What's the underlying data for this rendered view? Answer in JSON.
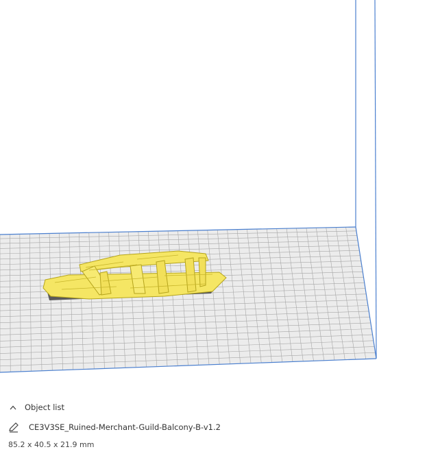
{
  "viewport": {
    "colors": {
      "background": "#ffffff",
      "plate": "#ececec",
      "grid": "#a6a6a6",
      "volume_edge": "#4a7fcf",
      "model": "#f5e664",
      "model_outline": "#b5a41c",
      "model_shadow": "#5a5a5a"
    }
  },
  "object_list": {
    "label": "Object list",
    "toggle_icon": "chevron-up-icon",
    "object_name": "CE3V3SE_Ruined-Merchant-Guild-Balcony-B-v1.2",
    "edit_icon": "pencil-icon",
    "dimensions": "85.2 x 40.5 x 21.9 mm"
  }
}
